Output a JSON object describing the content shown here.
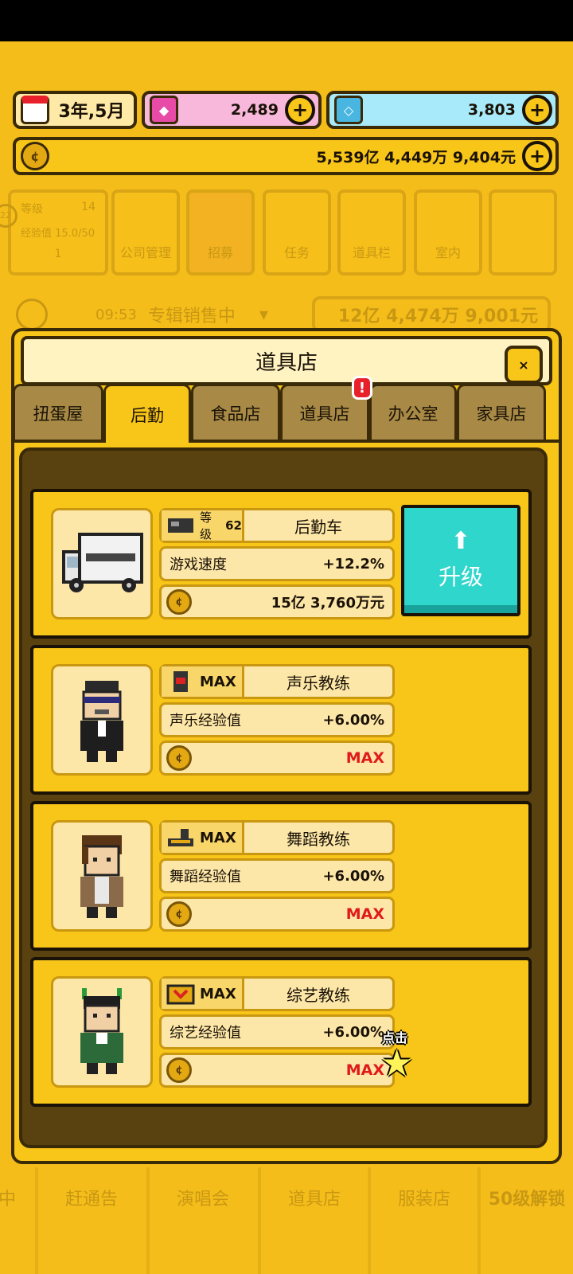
{
  "resources": {
    "date": "3年,5月",
    "gems": "2,489",
    "diamonds": "3,803",
    "money": "5,539亿 4,449万 9,404元"
  },
  "background": {
    "level_label": "等级",
    "level_value": "14",
    "exp_label": "经验值 15.0/50",
    "level_num": "1",
    "badge": "22",
    "nav": [
      "公司管理",
      "招募",
      "任务",
      "道具栏",
      "室内"
    ],
    "sales_time": "09:53",
    "sales_status": "专辑销售中",
    "sales_money": "12亿 4,474万 9,001元",
    "bottom_tabs": [
      "中",
      "赶通告",
      "演唱会",
      "道具店",
      "服装店",
      "50级解锁"
    ]
  },
  "shop": {
    "title": "道具店",
    "close_label": "×",
    "tabs": [
      {
        "label": "扭蛋屋",
        "active": false
      },
      {
        "label": "后勤",
        "active": true
      },
      {
        "label": "食品店",
        "active": false
      },
      {
        "label": "道具店",
        "active": false,
        "badge": "!"
      },
      {
        "label": "办公室",
        "active": false
      },
      {
        "label": "家具店",
        "active": false
      }
    ],
    "items": [
      {
        "level_label": "等级",
        "level": "62",
        "name": "后勤车",
        "stat": "游戏速度",
        "value": "+12.2%",
        "cost": "15亿 3,760万元",
        "icon": "van-icon"
      },
      {
        "level": "MAX",
        "name": "声乐教练",
        "stat": "声乐经验值",
        "value": "+6.00%",
        "cost": "MAX",
        "icon": "vocal-coach-icon"
      },
      {
        "level": "MAX",
        "name": "舞蹈教练",
        "stat": "舞蹈经验值",
        "value": "+6.00%",
        "cost": "MAX",
        "icon": "dance-coach-icon"
      },
      {
        "level": "MAX",
        "name": "综艺教练",
        "stat": "综艺经验值",
        "value": "+6.00%",
        "cost": "MAX",
        "icon": "variety-coach-icon"
      }
    ],
    "upgrade_label": "升级",
    "tap_hint": "点击"
  },
  "colors": {
    "accent": "#f8c519",
    "upgrade": "#2fd6cc",
    "max": "#e01a1a"
  }
}
